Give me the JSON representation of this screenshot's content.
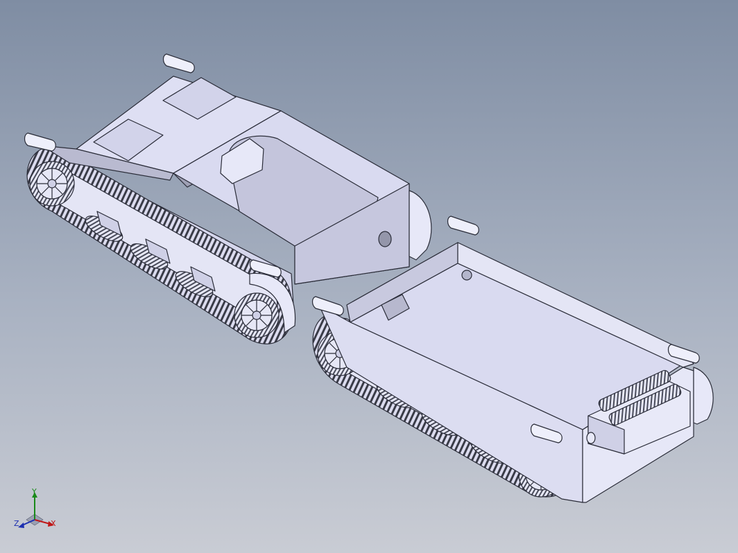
{
  "viewport": {
    "background_top": "#7f8da3",
    "background_bottom": "#c9ccd4",
    "model_face_color": "#e3e4f6",
    "model_edge_color": "#2a2c38",
    "track_color": "#d8d9ee"
  },
  "triad": {
    "x_label": "X",
    "y_label": "Y",
    "z_label": "Z",
    "x_color": "#c01818",
    "y_color": "#1a8a1a",
    "z_color": "#1c2fb0"
  }
}
